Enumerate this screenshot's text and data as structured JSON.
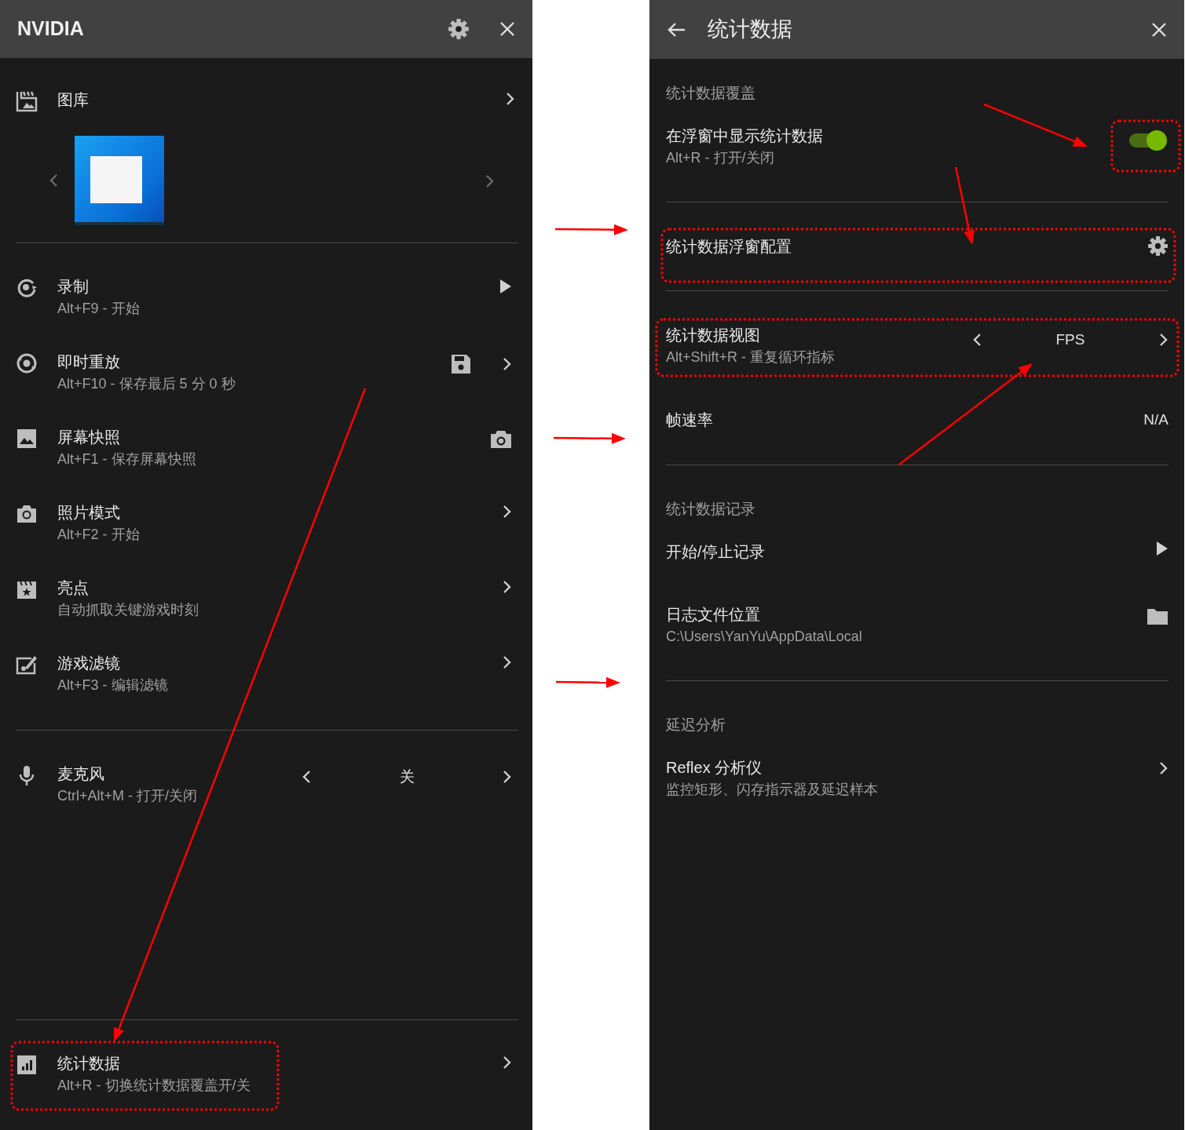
{
  "left_panel": {
    "title": "NVIDIA",
    "groups": [
      {
        "items": [
          {
            "kind": "gallery",
            "title": "图库"
          }
        ]
      },
      {
        "items": [
          {
            "kind": "play",
            "title": "录制",
            "subtitle": "Alt+F9 - 开始"
          },
          {
            "kind": "save",
            "title": "即时重放",
            "subtitle": "Alt+F10 - 保存最后 5 分 0 秒"
          },
          {
            "kind": "camera",
            "title": "屏幕快照",
            "subtitle": "Alt+F1 - 保存屏幕快照"
          },
          {
            "kind": "nav",
            "title": "照片模式",
            "subtitle": "Alt+F2 - 开始"
          },
          {
            "kind": "nav",
            "title": "亮点",
            "subtitle": "自动抓取关键游戏时刻"
          },
          {
            "kind": "nav",
            "title": "游戏滤镜",
            "subtitle": "Alt+F3 - 编辑滤镜"
          }
        ]
      },
      {
        "items": [
          {
            "kind": "selector",
            "title": "麦克风",
            "subtitle": "Ctrl+Alt+M - 打开/关闭",
            "value": "关"
          }
        ]
      },
      {
        "items": [
          {
            "kind": "nav",
            "title": "统计数据",
            "subtitle": "Alt+R - 切换统计数据覆盖开/关"
          }
        ]
      }
    ]
  },
  "right_panel": {
    "title": "统计数据",
    "sections": [
      {
        "heading": "统计数据覆盖",
        "items": [
          {
            "kind": "toggle",
            "title": "在浮窗中显示统计数据",
            "subtitle": "Alt+R - 打开/关闭",
            "on": true,
            "divider": true
          },
          {
            "kind": "gear",
            "title": "统计数据浮窗配置",
            "divider": true
          },
          {
            "kind": "selector",
            "title": "统计数据视图",
            "subtitle": "Alt+Shift+R - 重复循环指标",
            "value": "FPS",
            "divider": false
          },
          {
            "kind": "value",
            "title": "帧速率",
            "value": "N/A",
            "divider": true
          }
        ]
      },
      {
        "heading": "统计数据记录",
        "items": [
          {
            "kind": "play",
            "title": "开始/停止记录",
            "divider": false
          },
          {
            "kind": "folder",
            "title": "日志文件位置",
            "subtitle": "C:\\Users\\YanYu\\AppData\\Local",
            "divider": true
          }
        ]
      },
      {
        "heading": "延迟分析",
        "items": [
          {
            "kind": "nav",
            "title": "Reflex 分析仪",
            "subtitle": "监控矩形、闪存指示器及延迟样本",
            "divider": false
          }
        ]
      }
    ]
  }
}
